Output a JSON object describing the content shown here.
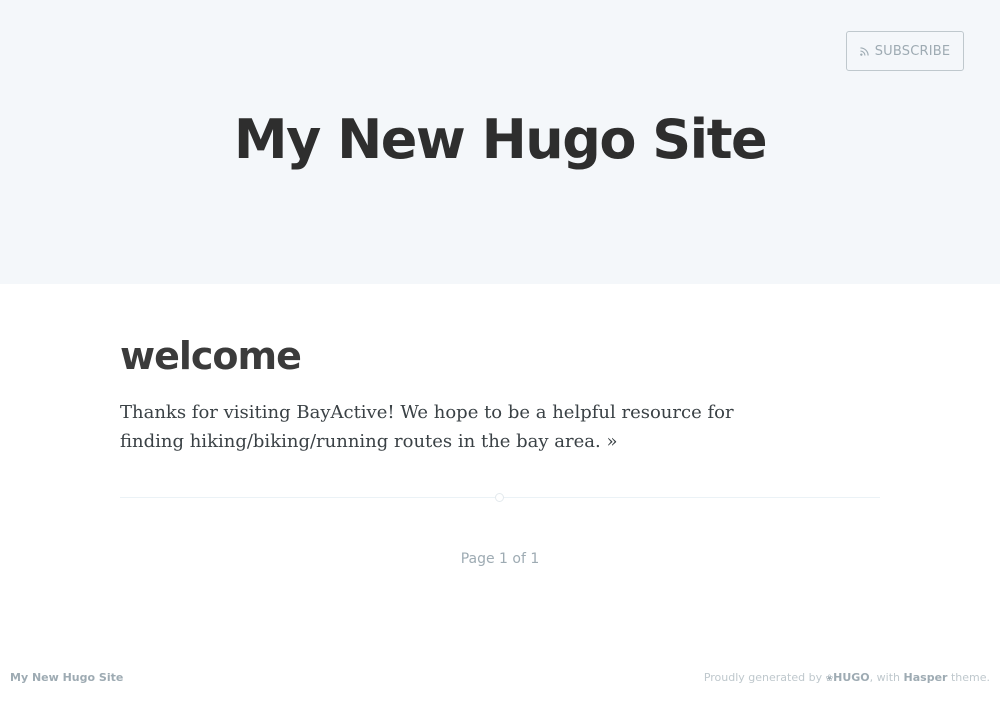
{
  "header": {
    "subscribe_label": "SUBSCRIBE",
    "subscribe_icon": "rss-icon",
    "site_title": "My New Hugo Site"
  },
  "post": {
    "title": "welcome",
    "excerpt": "Thanks for visiting BayActive! We hope to be a helpful resource for finding hiking/biking/running routes in the bay area.",
    "more_link": "»"
  },
  "pagination": {
    "text": "Page 1 of 1"
  },
  "footer": {
    "site_name": "My New Hugo Site",
    "credit_prefix": "Proudly generated by",
    "hugo_label": "HUGO",
    "credit_middle": ", with",
    "theme_name": "Hasper",
    "credit_suffix": "theme."
  },
  "colors": {
    "header_bg": "#f4f7fa",
    "title_text": "#2e2e2e",
    "muted_text": "#9eabb3"
  }
}
